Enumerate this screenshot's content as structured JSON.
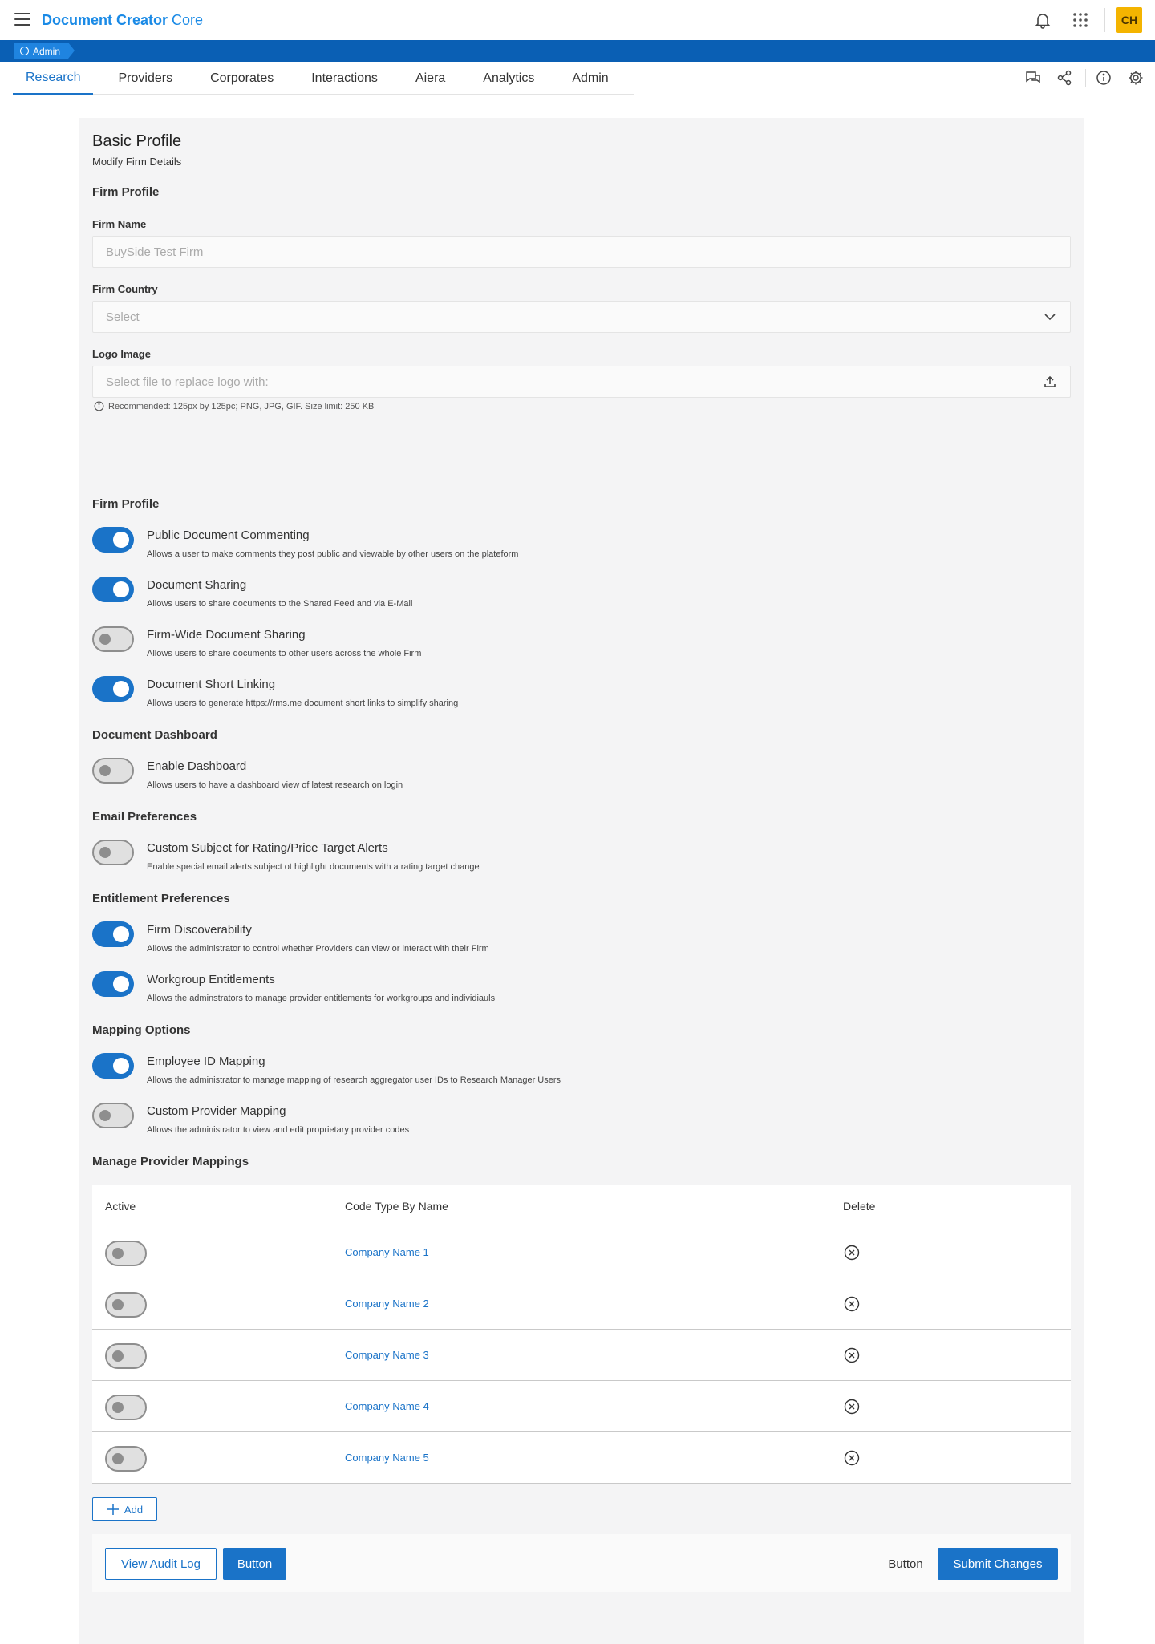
{
  "app": {
    "title_bold": "Document Creator",
    "title_light": "Core",
    "avatar_initials": "CH",
    "accent": "#1a73c8",
    "band_color": "#0a5fb4",
    "avatar_color": "#f4b400"
  },
  "breadcrumb": {
    "label": "Admin"
  },
  "tabs": [
    {
      "label": "Research",
      "active": true
    },
    {
      "label": "Providers"
    },
    {
      "label": "Corporates"
    },
    {
      "label": "Interactions"
    },
    {
      "label": "Aiera"
    },
    {
      "label": "Analytics"
    },
    {
      "label": "Admin"
    }
  ],
  "tab_icons": [
    "chat-icon",
    "share-icon",
    "info-icon",
    "gear-icon"
  ],
  "profile": {
    "title": "Basic Profile",
    "subtitle": "Modify Firm Details",
    "section": "Firm Profile",
    "firm_name_label": "Firm Name",
    "firm_name_placeholder": "BuySide Test Firm",
    "firm_country_label": "Firm Country",
    "firm_country_value": "Select",
    "logo_label": "Logo Image",
    "logo_placeholder": "Select file to replace logo with:",
    "logo_hint": "Recommended: 125px by 125pc; PNG, JPG, GIF. Size limit: 250 KB"
  },
  "sections": {
    "firm_profile": "Firm Profile",
    "document_dashboard": "Document Dashboard",
    "email_preferences": "Email Preferences",
    "entitlement_preferences": "Entitlement Preferences",
    "mapping_options": "Mapping Options",
    "manage_provider_mappings": "Manage Provider Mappings"
  },
  "toggles": {
    "public_commenting": {
      "name": "Public Document Commenting",
      "desc": "Allows a user to make comments they post public and viewable by other users on the plateform",
      "on": true
    },
    "document_sharing": {
      "name": "Document Sharing",
      "desc": "Allows users to share documents to the Shared Feed and via E-Mail",
      "on": true
    },
    "firm_wide_sharing": {
      "name": "Firm-Wide Document Sharing",
      "desc": "Allows users to share documents to other users across the whole Firm",
      "on": false
    },
    "short_linking": {
      "name": "Document Short Linking",
      "desc": "Allows users to generate https://rms.me document short links to simplify sharing",
      "on": true
    },
    "enable_dashboard": {
      "name": "Enable Dashboard",
      "desc": "Allows users to have a dashboard view of latest research on login",
      "on": false
    },
    "custom_subject": {
      "name": "Custom Subject for Rating/Price Target Alerts",
      "desc": "Enable special email alerts subject ot highlight documents with a rating target change",
      "on": false
    },
    "firm_discoverability": {
      "name": "Firm Discoverability",
      "desc": "Allows the administrator to control whether Providers can view or interact with their Firm",
      "on": true
    },
    "workgroup_entitlements": {
      "name": "Workgroup Entitlements",
      "desc": "Allows the adminstrators to manage provider entitlements for workgroups and individiauls",
      "on": true
    },
    "employee_id_mapping": {
      "name": "Employee ID Mapping",
      "desc": "Allows the administrator to manage mapping of research aggregator user IDs to Research Manager Users",
      "on": true
    },
    "custom_provider_mapping": {
      "name": "Custom Provider Mapping",
      "desc": "Allows the administrator to view and edit proprietary provider codes",
      "on": false
    }
  },
  "mapping_table": {
    "headers": {
      "active": "Active",
      "code": "Code Type By Name",
      "delete": "Delete"
    },
    "rows": [
      {
        "name": "Company Name 1",
        "active": false
      },
      {
        "name": "Company Name 2",
        "active": false
      },
      {
        "name": "Company Name 3",
        "active": false
      },
      {
        "name": "Company Name 4",
        "active": false
      },
      {
        "name": "Company Name 5",
        "active": false
      }
    ]
  },
  "actions": {
    "add": "Add",
    "view_audit_log": "View Audit Log",
    "button_primary": "Button",
    "button_text": "Button",
    "submit": "Submit Changes"
  }
}
